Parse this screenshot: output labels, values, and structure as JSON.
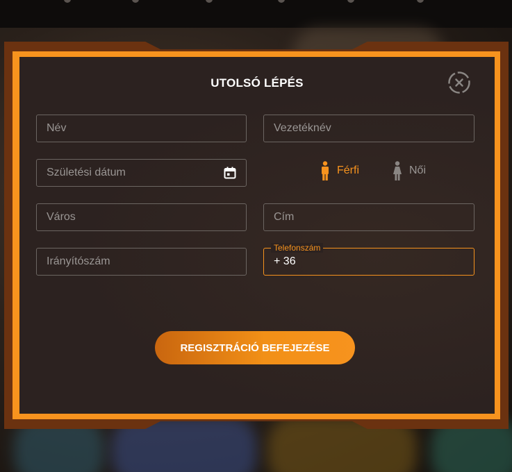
{
  "dialog": {
    "title": "UTOLSÓ LÉPÉS",
    "close_icon": "close-circle-icon"
  },
  "form": {
    "first_name_placeholder": "Név",
    "last_name_placeholder": "Vezetéknév",
    "birth_date_placeholder": "Születési dátum",
    "city_placeholder": "Város",
    "address_placeholder": "Cím",
    "zip_placeholder": "Irányítószám",
    "phone_label": "Telefonszám",
    "phone_value": "+ 36",
    "calendar_icon": "calendar-icon"
  },
  "gender": {
    "options": [
      {
        "label": "Férfi",
        "icon": "male-icon",
        "selected": true
      },
      {
        "label": "Női",
        "icon": "female-icon",
        "selected": false
      }
    ]
  },
  "actions": {
    "submit_label": "REGISZTRÁCIÓ BEFEJEZÉSE"
  },
  "colors": {
    "accent": "#f7931e",
    "panel": "#2c2220",
    "border": "#6c6662",
    "placeholder": "#9a9694",
    "muted_icon": "#8a8683"
  }
}
